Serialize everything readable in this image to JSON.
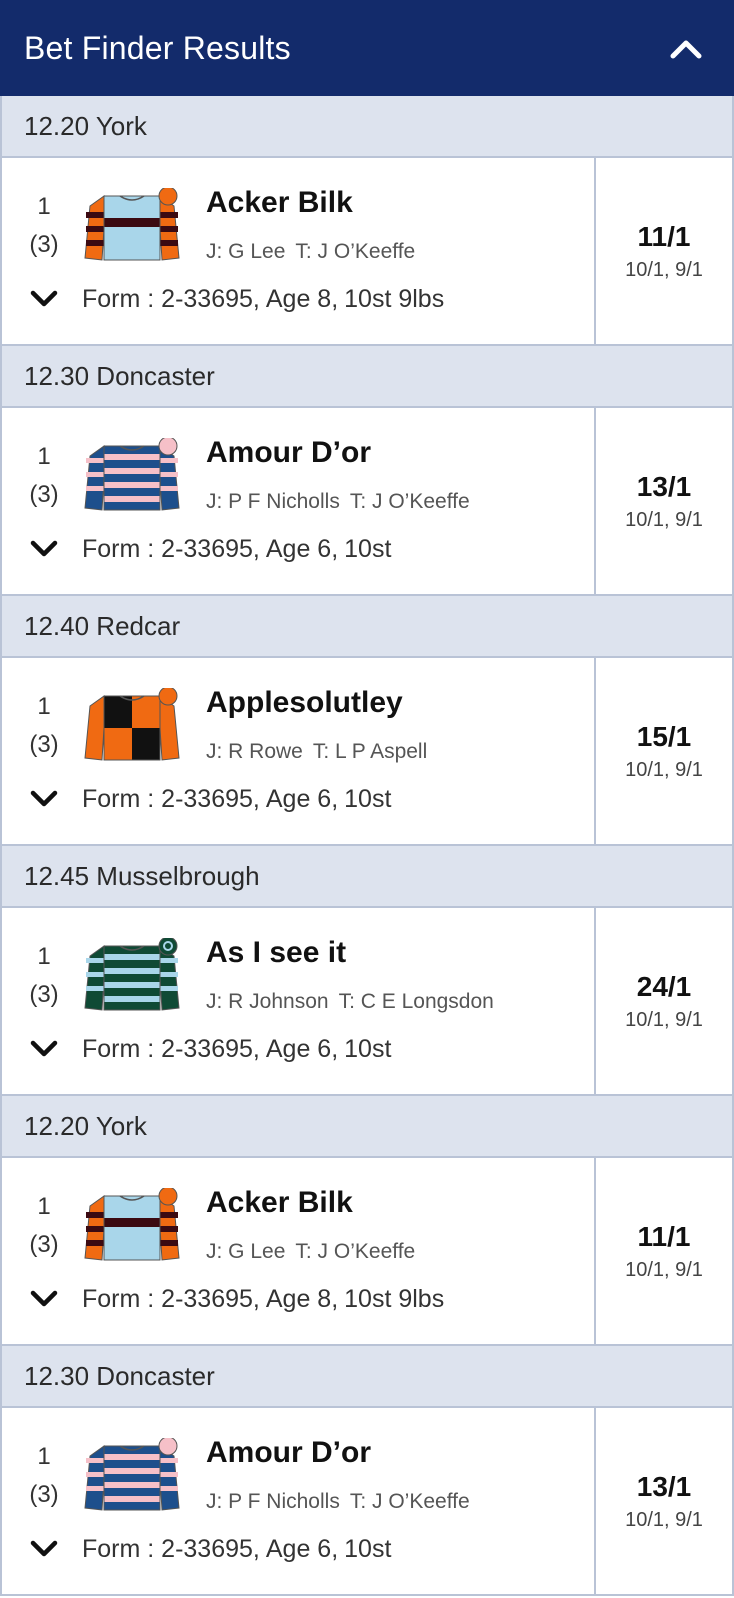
{
  "header": {
    "title": "Bet Finder Results",
    "collapse_icon": "chevron-up-icon"
  },
  "races": [
    {
      "race_label": "12.20 York",
      "runner": {
        "position": "1",
        "draw": "(3)",
        "name": "Acker Bilk",
        "jockey": "J: G Lee",
        "trainer": "T: J O’Keeffe",
        "form": "Form : 2-33695,",
        "age": "Age 8,",
        "weight": "10st 9lbs",
        "odds": "11/1",
        "prev_odds": "10/1, 9/1",
        "silk": {
          "body": "#a9d6ea",
          "sleeve": "#f06a12",
          "stripe": "#3b0a12",
          "cap": "#f06a12",
          "pattern": "hoop"
        }
      }
    },
    {
      "race_label": "12.30 Doncaster",
      "runner": {
        "position": "1",
        "draw": "(3)",
        "name": "Amour D’or",
        "jockey": "J: P F Nicholls",
        "trainer": "T: J O’Keeffe",
        "form": "Form : 2-33695,",
        "age": "Age 6,",
        "weight": "10st",
        "odds": "13/1",
        "prev_odds": "10/1, 9/1",
        "silk": {
          "body": "#1d4f8c",
          "sleeve": "#1d4f8c",
          "stripe": "#f6c0c8",
          "cap": "#f6c0c8",
          "pattern": "hoops"
        }
      }
    },
    {
      "race_label": "12.40 Redcar",
      "runner": {
        "position": "1",
        "draw": "(3)",
        "name": "Applesolutley",
        "jockey": "J: R Rowe",
        "trainer": "T: L P Aspell",
        "form": "Form : 2-33695,",
        "age": "Age 6,",
        "weight": "10st",
        "odds": "15/1",
        "prev_odds": "10/1, 9/1",
        "silk": {
          "body": "#f06a12",
          "sleeve": "#f06a12",
          "stripe": "#111111",
          "cap": "#f06a12",
          "pattern": "quartered"
        }
      }
    },
    {
      "race_label": "12.45 Musselbrough",
      "runner": {
        "position": "1",
        "draw": "(3)",
        "name": "As I see it",
        "jockey": "J: R Johnson",
        "trainer": "T: C E Longsdon",
        "form": "Form : 2-33695,",
        "age": "Age 6,",
        "weight": "10st",
        "odds": "24/1",
        "prev_odds": "10/1, 9/1",
        "silk": {
          "body": "#0f4a35",
          "sleeve": "#0f4a35",
          "stripe": "#a9d6ea",
          "cap": "#0f4a35",
          "pattern": "hoops"
        }
      }
    },
    {
      "race_label": "12.20 York",
      "runner": {
        "position": "1",
        "draw": "(3)",
        "name": "Acker Bilk",
        "jockey": "J: G Lee",
        "trainer": "T: J O’Keeffe",
        "form": "Form : 2-33695,",
        "age": "Age 8,",
        "weight": "10st 9lbs",
        "odds": "11/1",
        "prev_odds": "10/1, 9/1",
        "silk": {
          "body": "#a9d6ea",
          "sleeve": "#f06a12",
          "stripe": "#3b0a12",
          "cap": "#f06a12",
          "pattern": "hoop"
        }
      }
    },
    {
      "race_label": "12.30 Doncaster",
      "runner": {
        "position": "1",
        "draw": "(3)",
        "name": "Amour D’or",
        "jockey": "J: P F Nicholls",
        "trainer": "T: J O’Keeffe",
        "form": "Form : 2-33695,",
        "age": "Age 6,",
        "weight": "10st",
        "odds": "13/1",
        "prev_odds": "10/1, 9/1",
        "silk": {
          "body": "#1d4f8c",
          "sleeve": "#1d4f8c",
          "stripe": "#f6c0c8",
          "cap": "#f6c0c8",
          "pattern": "hoops"
        }
      }
    }
  ]
}
